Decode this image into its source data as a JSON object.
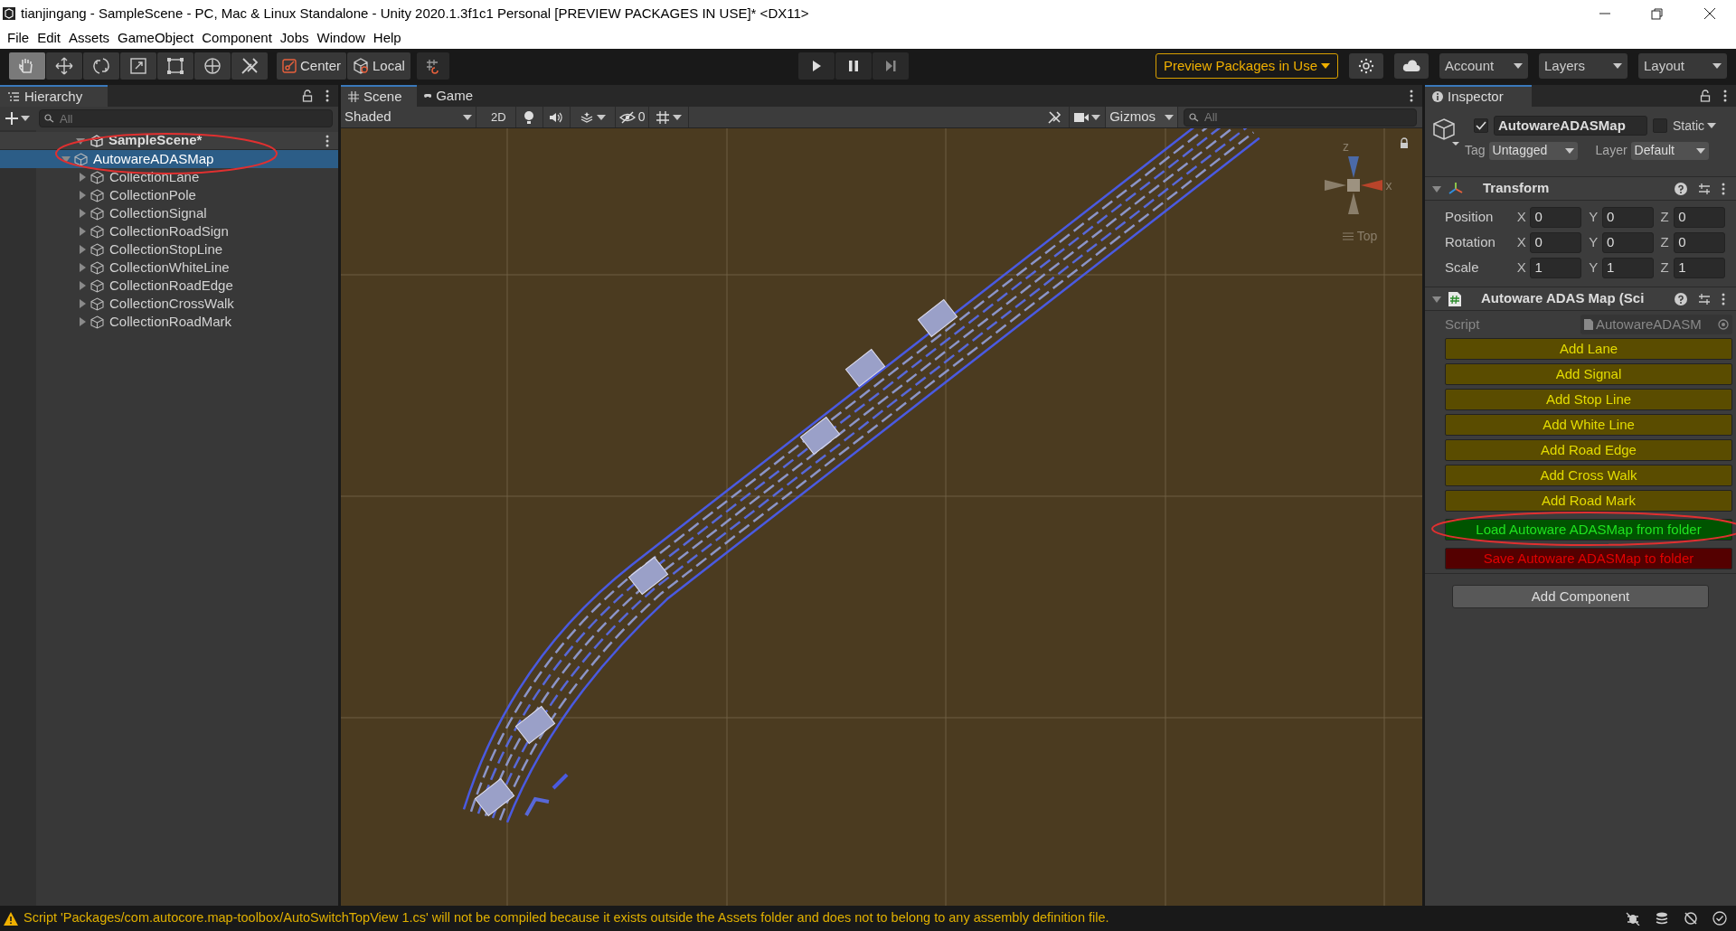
{
  "window": {
    "title": "tianjingang - SampleScene - PC, Mac & Linux Standalone - Unity 2020.1.3f1c1 Personal [PREVIEW PACKAGES IN USE]* <DX11>"
  },
  "menu": [
    "File",
    "Edit",
    "Assets",
    "GameObject",
    "Component",
    "Jobs",
    "Window",
    "Help"
  ],
  "toolbar": {
    "tools": [
      {
        "selected": true
      },
      {
        "selected": false
      },
      {
        "selected": false
      },
      {
        "selected": false
      },
      {
        "selected": false
      },
      {
        "selected": false
      },
      {
        "selected": false
      }
    ],
    "pivot": "Center",
    "space": "Local",
    "preview": "Preview Packages in Use",
    "account": "Account",
    "layers": "Layers",
    "layout": "Layout"
  },
  "hierarchy": {
    "title": "Hierarchy",
    "search_placeholder": "All",
    "scene": {
      "name": "SampleScene*",
      "expanded": true,
      "children": [
        {
          "name": "AutowareADASMap",
          "selected": true,
          "expanded": true,
          "children": [
            {
              "name": "CollectionLane",
              "selected": false,
              "expanded": false
            },
            {
              "name": "CollectionPole",
              "selected": false,
              "expanded": false
            },
            {
              "name": "CollectionSignal",
              "selected": false,
              "expanded": false
            },
            {
              "name": "CollectionRoadSign",
              "selected": false,
              "expanded": false
            },
            {
              "name": "CollectionStopLine",
              "selected": false,
              "expanded": false
            },
            {
              "name": "CollectionWhiteLine",
              "selected": false,
              "expanded": false
            },
            {
              "name": "CollectionRoadEdge",
              "selected": false,
              "expanded": false
            },
            {
              "name": "CollectionCrossWalk",
              "selected": false,
              "expanded": false
            },
            {
              "name": "CollectionRoadMark",
              "selected": false,
              "expanded": false
            }
          ]
        }
      ]
    }
  },
  "scene_view": {
    "tabs": [
      {
        "label": "Scene",
        "selected": true
      },
      {
        "label": "Game",
        "selected": false
      }
    ],
    "tools_on": false,
    "shading": "Shaded",
    "mode_2d": "2D",
    "hidden_count": "0",
    "gizmos": "Gizmos",
    "search_placeholder": "All",
    "axis_labels": {
      "z": "z",
      "x": "x"
    },
    "view_label": "Top"
  },
  "inspector": {
    "title": "Inspector",
    "object_name": "AutowareADASMap",
    "active": true,
    "static": false,
    "static_label": "Static",
    "tag_label": "Tag",
    "tag": "Untagged",
    "layer_label": "Layer",
    "layer": "Default",
    "transform": {
      "title": "Transform",
      "expanded": true,
      "rows": [
        {
          "label": "Position",
          "fields": [
            {
              "axis": "X",
              "value": "0"
            },
            {
              "axis": "Y",
              "value": "0"
            },
            {
              "axis": "Z",
              "value": "0"
            }
          ]
        },
        {
          "label": "Rotation",
          "fields": [
            {
              "axis": "X",
              "value": "0"
            },
            {
              "axis": "Y",
              "value": "0"
            },
            {
              "axis": "Z",
              "value": "0"
            }
          ]
        },
        {
          "label": "Scale",
          "fields": [
            {
              "axis": "X",
              "value": "1"
            },
            {
              "axis": "Y",
              "value": "1"
            },
            {
              "axis": "Z",
              "value": "1"
            }
          ]
        }
      ]
    },
    "script_component": {
      "title": "Autoware ADAS Map (Sci",
      "expanded": true,
      "script_label": "Script",
      "script": "AutowareADASM",
      "buttons": [
        {
          "label": "Add Lane",
          "kind": "add"
        },
        {
          "label": "Add Signal",
          "kind": "add"
        },
        {
          "label": "Add Stop Line",
          "kind": "add"
        },
        {
          "label": "Add White Line",
          "kind": "add"
        },
        {
          "label": "Add Road Edge",
          "kind": "add"
        },
        {
          "label": "Add Cross Walk",
          "kind": "add"
        },
        {
          "label": "Add Road Mark",
          "kind": "add"
        },
        {
          "label": "Load Autoware ADASMap from folder",
          "kind": "load"
        },
        {
          "label": "Save Autoware ADASMap to folder",
          "kind": "save"
        }
      ]
    },
    "add_component": "Add Component"
  },
  "status_bar": {
    "message": "Script 'Packages/com.autocore.map-toolbox/AutoSwitchTopView 1.cs' will not be compiled because it exists outside the Assets folder and does not to belong to any assembly definition file."
  }
}
